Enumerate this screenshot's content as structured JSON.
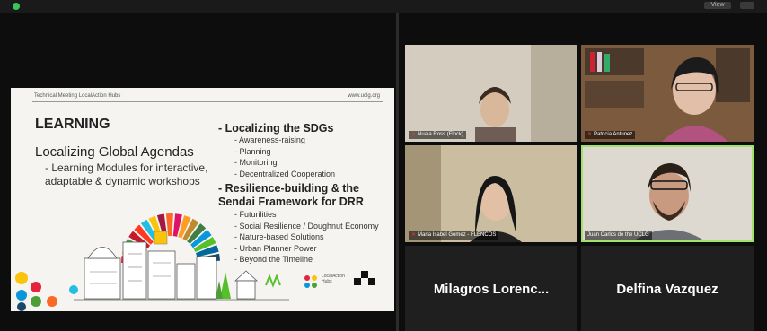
{
  "window": {
    "view_label": "View"
  },
  "slide": {
    "header_left": "Technical Meeting LocalAction Hubs",
    "header_right": "www.uclg.org",
    "title": "LEARNING",
    "subtitle": "Localizing Global Agendas",
    "modules_text": "- Learning Modules for interactive, adaptable & dynamic workshops",
    "section1_title": "- Localizing the SDGs",
    "section1_items": [
      "Awareness-raising",
      "Planning",
      "Monitoring",
      "Decentralized Cooperation"
    ],
    "section2_title_line1": "- Resilience-building & the",
    "section2_title_line2": "Sendai Framework for DRR",
    "section2_items": [
      "Futurilities",
      "Social Resilience / Doughnut Economy",
      "Nature-based Solutions",
      "Urban Planner Power",
      "Beyond the Timeline"
    ],
    "logo_text_line1": "LocalAction",
    "logo_text_line2": "Hubs",
    "sdg_colors": [
      "#e5243b",
      "#dda63a",
      "#4c9f38",
      "#c5192d",
      "#ff3a21",
      "#26bde2",
      "#fcc30b",
      "#a21942",
      "#fd6925",
      "#dd1367",
      "#fd9d24",
      "#bf8b2e",
      "#3f7e44",
      "#0a97d9",
      "#56c02b",
      "#00689d",
      "#19486a"
    ]
  },
  "participants": [
    {
      "label": "Nuala Ross (Flock)",
      "muted": true
    },
    {
      "label": "Patricia Antunez",
      "muted": true
    },
    {
      "label": "Maria Isabel Gomez - FLENCOS",
      "muted": true
    },
    {
      "label": "Juan Carlos de the UCLG",
      "muted": false
    },
    {
      "name": "Milagros Lorenc..."
    },
    {
      "name": "Delfina Vazquez"
    }
  ]
}
